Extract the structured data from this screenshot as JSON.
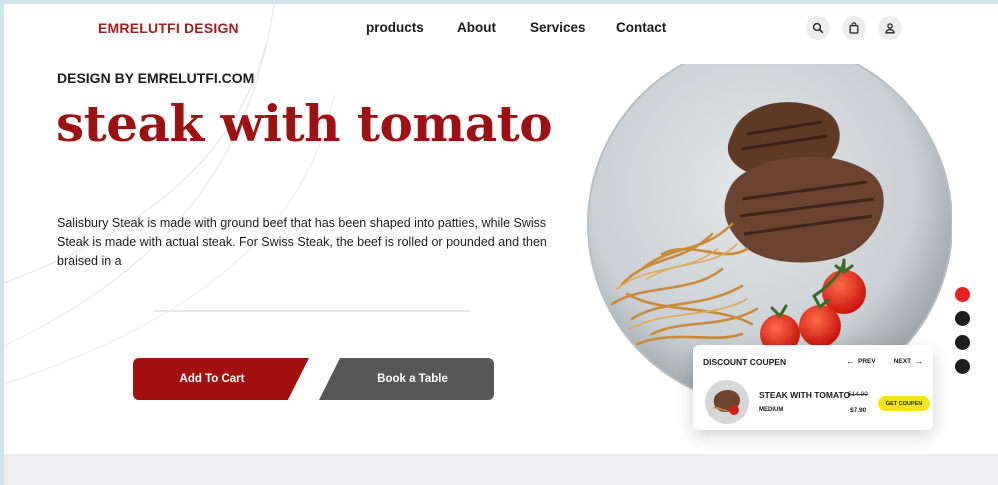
{
  "brand": {
    "logo": "EMRELUTFI DESIGN"
  },
  "nav": {
    "items": [
      "products",
      "About",
      "Services",
      "Contact"
    ]
  },
  "header_icons": [
    "search-icon",
    "bag-icon",
    "user-icon"
  ],
  "hero": {
    "eyebrow": "DESIGN BY EMRELUTFI.COM",
    "title": "steak with tomato",
    "description": "Salisbury Steak is made with ground beef that has been shaped into patties, while Swiss Steak is made with actual steak. For Swiss Steak, the beef is rolled or pounded and then braised in a",
    "add_to_cart": "Add To Cart",
    "book_table": "Book a Table"
  },
  "slider": {
    "count": 4,
    "active_index": 0
  },
  "coupon": {
    "title": "DISCOUNT COUPEN",
    "prev": "PREV",
    "next": "NEXT",
    "item_name": "STEAK WITH TOMATO",
    "old_price": "$14.99",
    "size": "MEDIUM",
    "price": "$7.90",
    "cta": "GET COUPEN"
  },
  "colors": {
    "brand": "#a31f1f",
    "title": "#9c1212",
    "cart_button": "#a40f0f",
    "book_button": "#575757",
    "active_dot": "#e8231d",
    "coupon_cta": "#f6e31a"
  }
}
